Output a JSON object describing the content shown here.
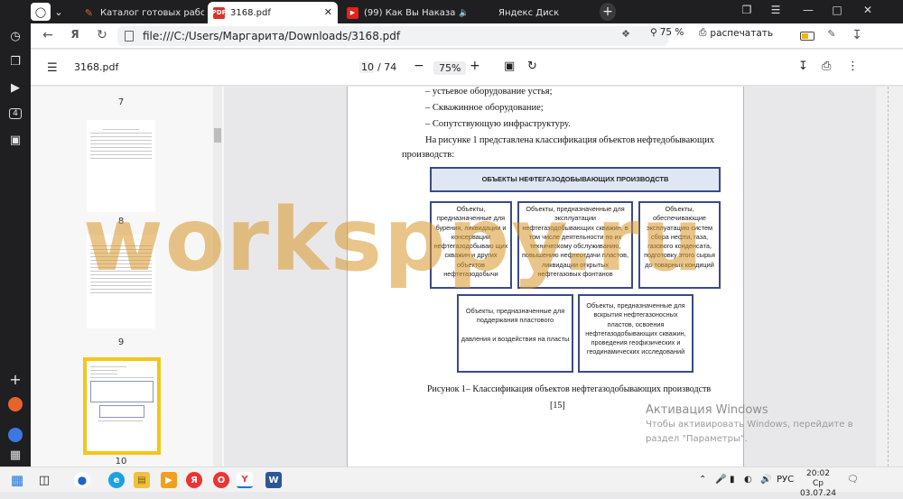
{
  "browser": {
    "tabs": [
      {
        "title": "Каталог готовых работ"
      },
      {
        "title": "3168.pdf",
        "favicon": "PDF"
      },
      {
        "title": "(99) Как Вы Наказа"
      },
      {
        "title": "Яндекс Диск"
      }
    ],
    "url": "file:///C:/Users/Маргарита/Downloads/3168.pdf",
    "zoom": "75 %",
    "print_label": "распечатать"
  },
  "pdf_toolbar": {
    "filename": "3168.pdf",
    "page_current": "10",
    "page_total": "/ 74",
    "zoom": "75%"
  },
  "thumbnails": {
    "page_numbers": [
      "7",
      "8",
      "9",
      "10"
    ],
    "selected_page": "10"
  },
  "document": {
    "lines": [
      "– устьевое оборудование устья;",
      "– Скважинное оборудование;",
      "– Сопутствующую инфраструктуру."
    ],
    "para_line1": [
      "На",
      "рисунке",
      "1",
      "представлена",
      "классификация",
      "объектов",
      "нефтедобывающих"
    ],
    "para_line2": "производств:",
    "diagram": {
      "header": "ОБЪЕКТЫ НЕФТЕГАЗОДОБЫВАЮЩИХ ПРОИЗВОДСТВ",
      "box1": "Объекты, предназначенные для бурения, ликвидации и консервации нефтегазодобываю щих скважин и других объектов нефтегазодобычи",
      "box2": "Объекты, предназначенные для эксплуатации нефтегазодобывающих скважин, в том числе деятельности по их техническому обслуживанию, повышению нефтеотдачи пластов, ликвидации открытых нефтегазовых фонтанов",
      "box3": "Объекты, обеспечивающие эксплуатацию систем сбора нефти, газа, газового конденсата, подготовку этого сырья до товарных кондиций",
      "box4a": "Объекты, предназначенные для поддержания пластового",
      "box4b": "давления и воздействия на пласты",
      "box5": "Объекты, предназначенные для вскрытия нефтегазоносных пластов, освоения нефтегазодобывающих скважин, проведения геофизических и геодинамических исследований"
    },
    "caption": "Рисунок 1– Классификация объектов нефтегазодобывающих производств",
    "ref": "[15]"
  },
  "watermark": "worksppy.ru",
  "activation": {
    "title": "Активация Windows",
    "line1": "Чтобы активировать Windows, перейдите в",
    "line2": "раздел \"Параметры\"."
  },
  "taskbar": {
    "lang": "РУС",
    "time": "20:02",
    "date": "Ср 03.07.24"
  }
}
